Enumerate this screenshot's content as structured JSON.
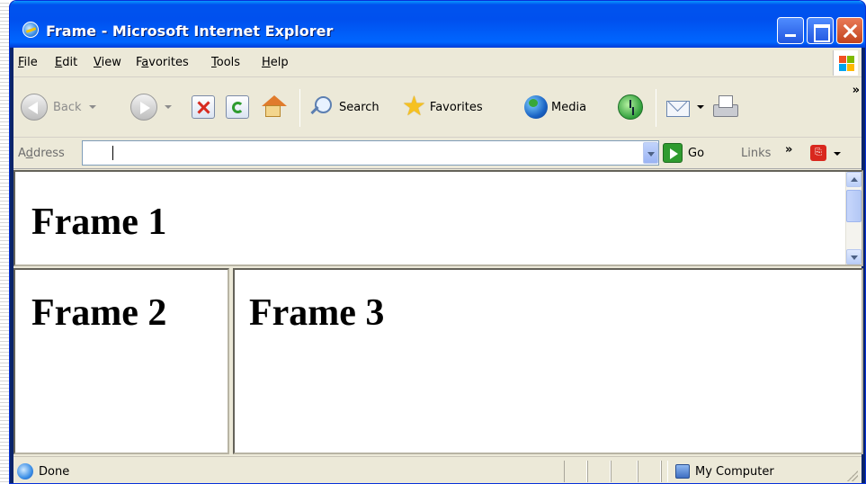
{
  "window": {
    "title": "Frame - Microsoft Internet Explorer"
  },
  "menu": [
    {
      "label": "File",
      "accel": "F",
      "rest": "ile"
    },
    {
      "label": "Edit",
      "accel": "E",
      "rest": "dit"
    },
    {
      "label": "View",
      "accel": "V",
      "rest": "iew"
    },
    {
      "label": "Favorites",
      "accel": "a",
      "pre": "F",
      "rest": "vorites"
    },
    {
      "label": "Tools",
      "accel": "T",
      "rest": "ools"
    },
    {
      "label": "Help",
      "accel": "H",
      "rest": "elp"
    }
  ],
  "toolbar": {
    "back_label": "Back",
    "search_label": "Search",
    "favorites_label": "Favorites",
    "media_label": "Media",
    "more": "»"
  },
  "address": {
    "label_pre": "A",
    "label_accel": "d",
    "label_rest": "dress",
    "value": "",
    "go_label": "Go",
    "links_label": "Links",
    "links_more": "»"
  },
  "frames": {
    "frame1": "Frame 1",
    "frame2": "Frame 2",
    "frame3": "Frame 3"
  },
  "status": {
    "text": "Done",
    "zone": "My Computer"
  },
  "colors": {
    "titlebar": "#0054e3",
    "chrome": "#ece9d8",
    "close_button": "#c2431e"
  }
}
